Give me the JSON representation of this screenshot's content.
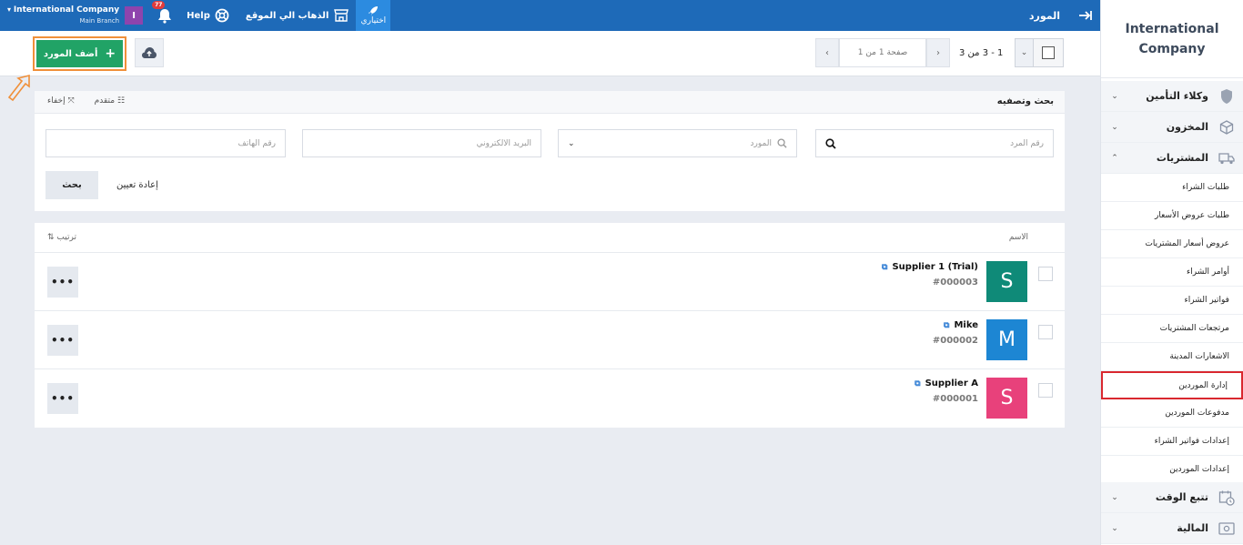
{
  "topbar": {
    "page_title": "المورد",
    "shortcut_label": "اختياري",
    "visit_site": "الذهاب الي الموقع",
    "help": "Help",
    "notifications_count": "77",
    "user_initial": "I",
    "company_name": "International Company",
    "branch": "Main Branch",
    "bar_color": "#1e6ab8"
  },
  "actions": {
    "add_supplier": "أضف المورد",
    "add_color": "#21a366",
    "range": "1 - 3 من 3",
    "page_placeholder": "صفحة 1 من 1"
  },
  "search": {
    "title": "بحث وتصفيه",
    "advanced": "متقدم",
    "hide": "إخفاء",
    "code_placeholder": "رقم المرد",
    "supplier_placeholder": "المورد",
    "email_placeholder": "البريد الالكتروني",
    "phone_placeholder": "رقم الهاتف",
    "search_button": "بحث",
    "reset_button": "إعادة تعيين"
  },
  "results": {
    "col_name": "الاسم",
    "sort": "ترتيب",
    "rows": [
      {
        "initial": "S",
        "name": "Supplier 1 (Trial)",
        "number": "#000003",
        "color": "#0f8a78"
      },
      {
        "initial": "M",
        "name": "Mike",
        "number": "#000002",
        "color": "#1d86d3"
      },
      {
        "initial": "S",
        "name": "Supplier A",
        "number": "#000001",
        "color": "#e8417b"
      }
    ],
    "more": "•••"
  },
  "sidebar": {
    "brand_line1": "International",
    "brand_line2": "Company",
    "sections": [
      {
        "label": "وكلاء التأمين"
      },
      {
        "label": "المخزون"
      },
      {
        "label": "المشتريات"
      }
    ],
    "sub_items": [
      "طلبات الشراء",
      "طلبات عروض الأسعار",
      "عروض أسعار المشتريات",
      "أوامر الشراء",
      "فواتير الشراء",
      "مرتجعات المشتريات",
      "الاشعارات المدينة",
      "إدارة الموردين",
      "مدفوعات الموردين",
      "إعدادات فواتير الشراء",
      "إعدادات الموردين"
    ],
    "bottom_sections": [
      {
        "label": "تتبع الوقت"
      },
      {
        "label": "المالية"
      }
    ]
  }
}
